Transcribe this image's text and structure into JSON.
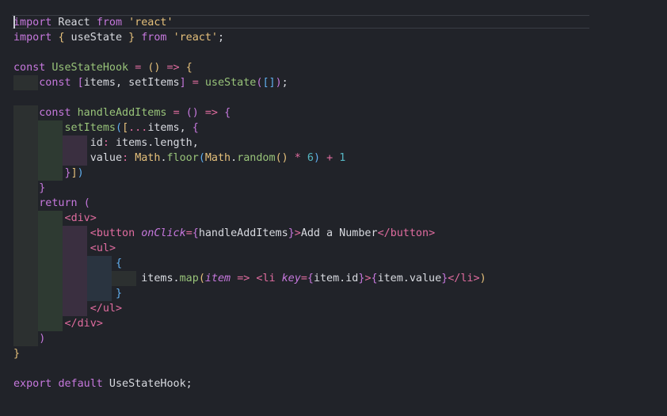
{
  "editor": {
    "colors": {
      "background": "#212329",
      "keyword": "#c678dd",
      "function": "#61afef",
      "declaration": "#98c379",
      "string": "#e5c07b",
      "text": "#d8dae0"
    },
    "lines": [
      [
        {
          "t": "import",
          "c": "k"
        },
        {
          "t": " React ",
          "c": ""
        },
        {
          "t": "from",
          "c": "k"
        },
        {
          "t": " ",
          "c": ""
        },
        {
          "t": "'react'",
          "c": "s"
        }
      ],
      [
        {
          "t": "import",
          "c": "k"
        },
        {
          "t": " ",
          "c": ""
        },
        {
          "t": "{",
          "c": "b1"
        },
        {
          "t": " useState ",
          "c": ""
        },
        {
          "t": "}",
          "c": "b1"
        },
        {
          "t": " ",
          "c": ""
        },
        {
          "t": "from",
          "c": "k"
        },
        {
          "t": " ",
          "c": ""
        },
        {
          "t": "'react'",
          "c": "s"
        },
        {
          "t": ";",
          "c": ""
        }
      ],
      [],
      [
        {
          "t": "const",
          "c": "k"
        },
        {
          "t": " ",
          "c": ""
        },
        {
          "t": "UseStateHook",
          "c": "d"
        },
        {
          "t": " ",
          "c": ""
        },
        {
          "t": "=",
          "c": "p"
        },
        {
          "t": " ",
          "c": ""
        },
        {
          "t": "()",
          "c": "b1"
        },
        {
          "t": " ",
          "c": ""
        },
        {
          "t": "=>",
          "c": "p"
        },
        {
          "t": " ",
          "c": ""
        },
        {
          "t": "{",
          "c": "b1"
        }
      ],
      [
        {
          "t": "    ",
          "c": ""
        },
        {
          "t": "const",
          "c": "k"
        },
        {
          "t": " ",
          "c": ""
        },
        {
          "t": "[",
          "c": "b2"
        },
        {
          "t": "items, setItems",
          "c": ""
        },
        {
          "t": "]",
          "c": "b2"
        },
        {
          "t": " ",
          "c": ""
        },
        {
          "t": "=",
          "c": "p"
        },
        {
          "t": " ",
          "c": ""
        },
        {
          "t": "useState",
          "c": "d"
        },
        {
          "t": "(",
          "c": "b2"
        },
        {
          "t": "[]",
          "c": "b3"
        },
        {
          "t": ")",
          "c": "b2"
        },
        {
          "t": ";",
          "c": ""
        }
      ],
      [],
      [
        {
          "t": "    ",
          "c": ""
        },
        {
          "t": "const",
          "c": "k"
        },
        {
          "t": " ",
          "c": ""
        },
        {
          "t": "handleAddItems",
          "c": "d"
        },
        {
          "t": " ",
          "c": ""
        },
        {
          "t": "=",
          "c": "p"
        },
        {
          "t": " ",
          "c": ""
        },
        {
          "t": "()",
          "c": "b2"
        },
        {
          "t": " ",
          "c": ""
        },
        {
          "t": "=>",
          "c": "p"
        },
        {
          "t": " ",
          "c": ""
        },
        {
          "t": "{",
          "c": "b2"
        }
      ],
      [
        {
          "t": "        ",
          "c": ""
        },
        {
          "t": "setItems",
          "c": "d"
        },
        {
          "t": "(",
          "c": "b3"
        },
        {
          "t": "[",
          "c": "b1"
        },
        {
          "t": "...",
          "c": "p"
        },
        {
          "t": "items, ",
          "c": ""
        },
        {
          "t": "{",
          "c": "b2"
        }
      ],
      [
        {
          "t": "            ",
          "c": ""
        },
        {
          "t": "id",
          "c": ""
        },
        {
          "t": ":",
          "c": "p"
        },
        {
          "t": " items.length,",
          "c": ""
        }
      ],
      [
        {
          "t": "            ",
          "c": ""
        },
        {
          "t": "value",
          "c": ""
        },
        {
          "t": ":",
          "c": "p"
        },
        {
          "t": " ",
          "c": ""
        },
        {
          "t": "Math",
          "c": "m"
        },
        {
          "t": ".",
          "c": ""
        },
        {
          "t": "floor",
          "c": "d"
        },
        {
          "t": "(",
          "c": "b3"
        },
        {
          "t": "Math",
          "c": "m"
        },
        {
          "t": ".",
          "c": ""
        },
        {
          "t": "random",
          "c": "d"
        },
        {
          "t": "()",
          "c": "b1"
        },
        {
          "t": " ",
          "c": ""
        },
        {
          "t": "*",
          "c": "p"
        },
        {
          "t": " ",
          "c": ""
        },
        {
          "t": "6",
          "c": "n"
        },
        {
          "t": ")",
          "c": "b3"
        },
        {
          "t": " ",
          "c": ""
        },
        {
          "t": "+",
          "c": "p"
        },
        {
          "t": " ",
          "c": ""
        },
        {
          "t": "1",
          "c": "n"
        }
      ],
      [
        {
          "t": "        ",
          "c": ""
        },
        {
          "t": "}",
          "c": "b2"
        },
        {
          "t": "]",
          "c": "b1"
        },
        {
          "t": ")",
          "c": "b3"
        }
      ],
      [
        {
          "t": "    ",
          "c": ""
        },
        {
          "t": "}",
          "c": "b2"
        }
      ],
      [
        {
          "t": "    ",
          "c": ""
        },
        {
          "t": "return",
          "c": "k"
        },
        {
          "t": " ",
          "c": ""
        },
        {
          "t": "(",
          "c": "b2"
        }
      ],
      [
        {
          "t": "        ",
          "c": ""
        },
        {
          "t": "<",
          "c": "p"
        },
        {
          "t": "div",
          "c": "p"
        },
        {
          "t": ">",
          "c": "p"
        }
      ],
      [
        {
          "t": "            ",
          "c": ""
        },
        {
          "t": "<",
          "c": "p"
        },
        {
          "t": "button",
          "c": "p"
        },
        {
          "t": " ",
          "c": ""
        },
        {
          "t": "onClick",
          "c": "a"
        },
        {
          "t": "=",
          "c": "p"
        },
        {
          "t": "{",
          "c": "b2"
        },
        {
          "t": "handleAddItems",
          "c": ""
        },
        {
          "t": "}",
          "c": "b2"
        },
        {
          "t": ">",
          "c": "p"
        },
        {
          "t": "Add a Number",
          "c": ""
        },
        {
          "t": "</",
          "c": "p"
        },
        {
          "t": "button",
          "c": "p"
        },
        {
          "t": ">",
          "c": "p"
        }
      ],
      [
        {
          "t": "            ",
          "c": ""
        },
        {
          "t": "<",
          "c": "p"
        },
        {
          "t": "ul",
          "c": "p"
        },
        {
          "t": ">",
          "c": "p"
        }
      ],
      [
        {
          "t": "                ",
          "c": ""
        },
        {
          "t": "{",
          "c": "b3"
        }
      ],
      [
        {
          "t": "                    ",
          "c": ""
        },
        {
          "t": "items.",
          "c": ""
        },
        {
          "t": "map",
          "c": "d"
        },
        {
          "t": "(",
          "c": "b1"
        },
        {
          "t": "item",
          "c": "a"
        },
        {
          "t": " ",
          "c": ""
        },
        {
          "t": "=>",
          "c": "p"
        },
        {
          "t": " ",
          "c": ""
        },
        {
          "t": "<",
          "c": "p"
        },
        {
          "t": "li",
          "c": "p"
        },
        {
          "t": " ",
          "c": ""
        },
        {
          "t": "key",
          "c": "a"
        },
        {
          "t": "=",
          "c": "p"
        },
        {
          "t": "{",
          "c": "b2"
        },
        {
          "t": "item.id",
          "c": ""
        },
        {
          "t": "}",
          "c": "b2"
        },
        {
          "t": ">",
          "c": "p"
        },
        {
          "t": "{",
          "c": "b2"
        },
        {
          "t": "item.value",
          "c": ""
        },
        {
          "t": "}",
          "c": "b2"
        },
        {
          "t": "</",
          "c": "p"
        },
        {
          "t": "li",
          "c": "p"
        },
        {
          "t": ">",
          "c": "p"
        },
        {
          "t": ")",
          "c": "b1"
        }
      ],
      [
        {
          "t": "                ",
          "c": ""
        },
        {
          "t": "}",
          "c": "b3"
        }
      ],
      [
        {
          "t": "            ",
          "c": ""
        },
        {
          "t": "</",
          "c": "p"
        },
        {
          "t": "ul",
          "c": "p"
        },
        {
          "t": ">",
          "c": "p"
        }
      ],
      [
        {
          "t": "        ",
          "c": ""
        },
        {
          "t": "</",
          "c": "p"
        },
        {
          "t": "div",
          "c": "p"
        },
        {
          "t": ">",
          "c": "p"
        }
      ],
      [
        {
          "t": "    ",
          "c": ""
        },
        {
          "t": ")",
          "c": "b2"
        }
      ],
      [
        {
          "t": "}",
          "c": "b1"
        }
      ],
      [],
      [
        {
          "t": "export",
          "c": "k"
        },
        {
          "t": " ",
          "c": ""
        },
        {
          "t": "default",
          "c": "k"
        },
        {
          "t": " UseStateHook;",
          "c": ""
        }
      ]
    ]
  }
}
